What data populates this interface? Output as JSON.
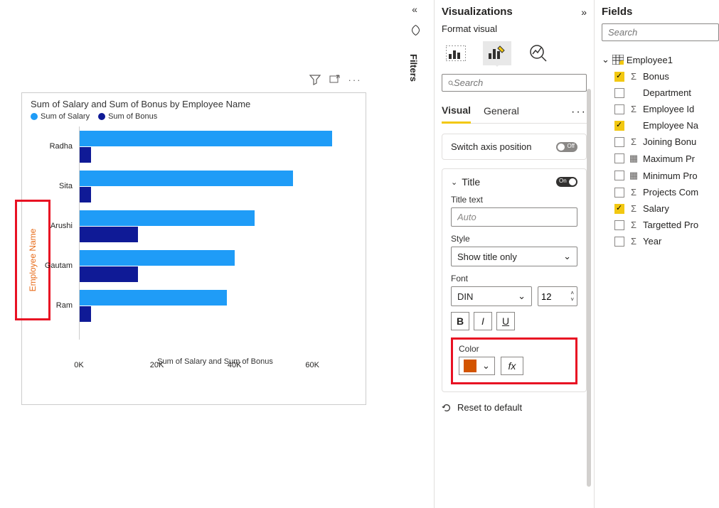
{
  "chart_data": {
    "type": "bar",
    "orientation": "horizontal",
    "title": "Sum of Salary and Sum of Bonus by Employee Name",
    "xlabel": "Sum of Salary and Sum of Bonus",
    "ylabel": "Employee Name",
    "categories": [
      "Radha",
      "Sita",
      "Arushi",
      "Gautam",
      "Ram"
    ],
    "series": [
      {
        "name": "Sum of Salary",
        "color": "#1f9cf7",
        "values": [
          65000,
          55000,
          45000,
          40000,
          38000
        ]
      },
      {
        "name": "Sum of Bonus",
        "color": "#0f1a96",
        "values": [
          3000,
          3000,
          15000,
          15000,
          3000
        ]
      }
    ],
    "xticks": [
      "0K",
      "20K",
      "40K",
      "60K"
    ],
    "xlim": [
      0,
      70000
    ]
  },
  "filters": {
    "label": "Filters"
  },
  "vis": {
    "title": "Visualizations",
    "sub": "Format visual",
    "search_placeholder": "Search",
    "tabs": {
      "visual": "Visual",
      "general": "General"
    },
    "switch_axis": {
      "label": "Switch axis position",
      "state": "Off"
    },
    "title_section": {
      "header": "Title",
      "state": "On",
      "title_text_label": "Title text",
      "title_text_value": "Auto",
      "style_label": "Style",
      "style_value": "Show title only",
      "font_label": "Font",
      "font_family": "DIN",
      "font_size": "12",
      "color_label": "Color",
      "color_value": "#d35400"
    },
    "reset": "Reset to default"
  },
  "fields": {
    "title": "Fields",
    "search_placeholder": "Search",
    "table": "Employee1",
    "items": [
      {
        "label": "Bonus",
        "checked": true,
        "icon": "Σ"
      },
      {
        "label": "Department",
        "checked": false,
        "icon": ""
      },
      {
        "label": "Employee Id",
        "checked": false,
        "icon": "Σ"
      },
      {
        "label": "Employee Na",
        "checked": true,
        "icon": ""
      },
      {
        "label": "Joining Bonu",
        "checked": false,
        "icon": "Σ"
      },
      {
        "label": "Maximum Pr",
        "checked": false,
        "icon": "▦"
      },
      {
        "label": "Minimum Pro",
        "checked": false,
        "icon": "▦"
      },
      {
        "label": "Projects Com",
        "checked": false,
        "icon": "Σ"
      },
      {
        "label": "Salary",
        "checked": true,
        "icon": "Σ"
      },
      {
        "label": "Targetted Pro",
        "checked": false,
        "icon": "Σ"
      },
      {
        "label": "Year",
        "checked": false,
        "icon": "Σ"
      }
    ]
  }
}
